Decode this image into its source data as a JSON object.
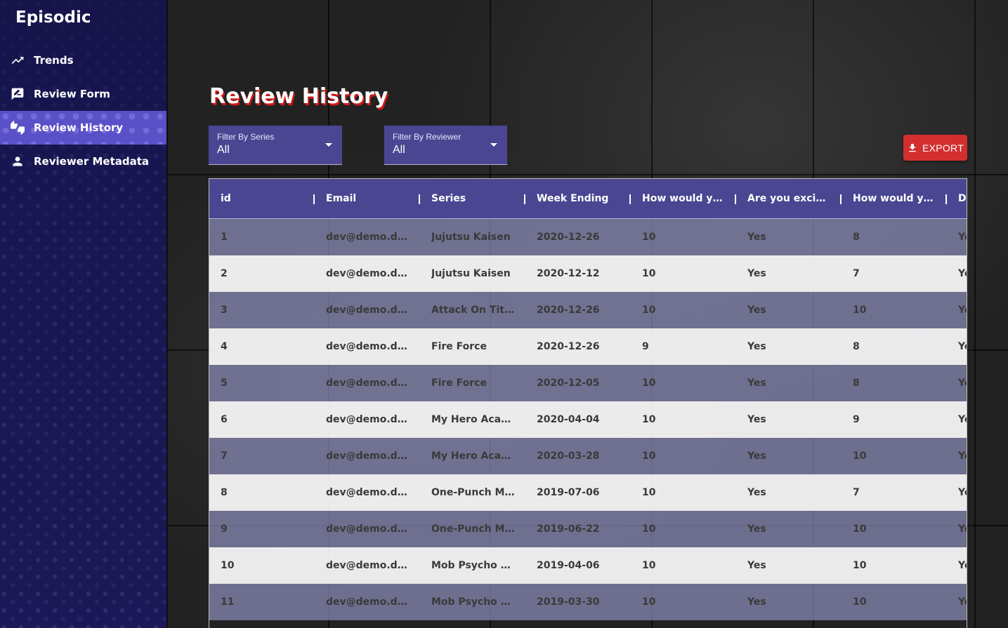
{
  "app": {
    "title": "Episodic"
  },
  "sidebar": {
    "items": [
      {
        "label": "Trends",
        "icon": "trending-up-icon",
        "active": false
      },
      {
        "label": "Review Form",
        "icon": "rate-review-icon",
        "active": false
      },
      {
        "label": "Review History",
        "icon": "thumbs-up-down-icon",
        "active": true
      },
      {
        "label": "Reviewer Metadata",
        "icon": "person-icon",
        "active": false
      }
    ]
  },
  "main": {
    "title": "Review History",
    "filters": {
      "series": {
        "label": "Filter By Series",
        "value": "All"
      },
      "reviewer": {
        "label": "Filter By Reviewer",
        "value": "All"
      }
    },
    "export_label": "EXPORT"
  },
  "table": {
    "columns": [
      "id",
      "Email",
      "Series",
      "Week Ending",
      "How would yo...",
      "Are you excit...",
      "How would yo...",
      "D"
    ],
    "rows": [
      [
        "1",
        "dev@demo.dev",
        "Jujutsu Kaisen",
        "2020-12-26",
        "10",
        "Yes",
        "8",
        "Ye"
      ],
      [
        "2",
        "dev@demo.dev",
        "Jujutsu Kaisen",
        "2020-12-12",
        "10",
        "Yes",
        "7",
        "Ye"
      ],
      [
        "3",
        "dev@demo.dev",
        "Attack On Titan",
        "2020-12-26",
        "10",
        "Yes",
        "10",
        "Ye"
      ],
      [
        "4",
        "dev@demo.dev",
        "Fire Force",
        "2020-12-26",
        "9",
        "Yes",
        "8",
        "Ye"
      ],
      [
        "5",
        "dev@demo.dev",
        "Fire Force",
        "2020-12-05",
        "10",
        "Yes",
        "8",
        "Ye"
      ],
      [
        "6",
        "dev@demo.dev",
        "My Hero Acad...",
        "2020-04-04",
        "10",
        "Yes",
        "9",
        "Ye"
      ],
      [
        "7",
        "dev@demo.dev",
        "My Hero Acad...",
        "2020-03-28",
        "10",
        "Yes",
        "10",
        "Ye"
      ],
      [
        "8",
        "dev@demo.dev",
        "One-Punch Man",
        "2019-07-06",
        "10",
        "Yes",
        "7",
        "Ye"
      ],
      [
        "9",
        "dev@demo.dev",
        "One-Punch Man",
        "2019-06-22",
        "10",
        "Yes",
        "10",
        "Ye"
      ],
      [
        "10",
        "dev@demo.dev",
        "Mob Psycho 1...",
        "2019-04-06",
        "10",
        "Yes",
        "10",
        "Ye"
      ],
      [
        "11",
        "dev@demo.dev",
        "Mob Psycho 1...",
        "2019-03-30",
        "10",
        "Yes",
        "10",
        "Ye"
      ]
    ]
  },
  "colors": {
    "sidebar": "#1e1c5e",
    "accent": "#4a4691",
    "active_nav": "#5a50c8",
    "export": "#d32f2f",
    "title_shadow": "#d01818"
  }
}
